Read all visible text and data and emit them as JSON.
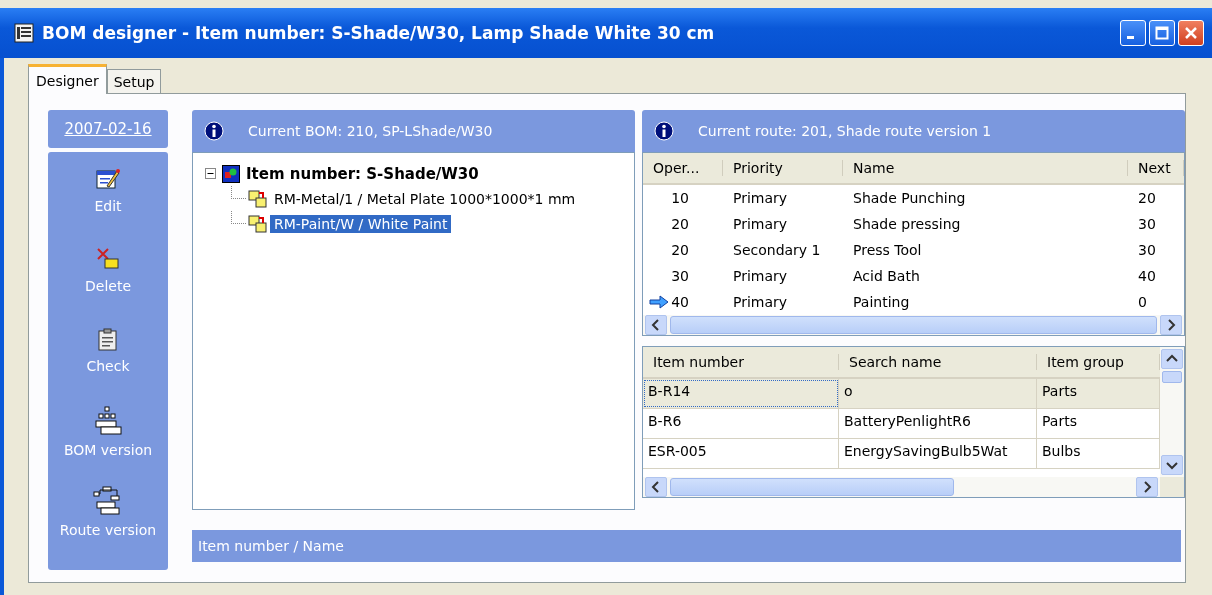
{
  "window": {
    "title": "BOM designer - Item number: S-Shade/W30, Lamp Shade White 30 cm"
  },
  "tabs": [
    {
      "label": "Designer",
      "selected": true
    },
    {
      "label": "Setup",
      "selected": false
    }
  ],
  "sidebar": {
    "date": "2007-02-16",
    "actions": [
      {
        "label": "Edit"
      },
      {
        "label": "Delete"
      },
      {
        "label": "Check"
      },
      {
        "label": "BOM version"
      },
      {
        "label": "Route version"
      }
    ]
  },
  "bom": {
    "header": "Current BOM:  210, SP-LShade/W30",
    "tree": {
      "label": "Item number: S-Shade/W30",
      "expanded": true,
      "children": [
        {
          "label": "RM-Metal/1 / Metal Plate 1000*1000*1 mm",
          "selected": false
        },
        {
          "label": "RM-Paint/W / White Paint",
          "selected": true
        }
      ]
    }
  },
  "route": {
    "header": "Current route:  201, Shade route version 1",
    "columns": [
      "Oper...",
      "Priority",
      "Name",
      "Next"
    ],
    "rows": [
      {
        "cells": [
          "10",
          "Primary",
          "Shade Punching",
          "20"
        ],
        "current": false
      },
      {
        "cells": [
          "20",
          "Primary",
          "Shade pressing",
          "30"
        ],
        "current": false
      },
      {
        "cells": [
          "20",
          "Secondary 1",
          "Press Tool",
          "30"
        ],
        "current": false
      },
      {
        "cells": [
          "30",
          "Primary",
          "Acid Bath",
          "40"
        ],
        "current": false
      },
      {
        "cells": [
          "40",
          "Primary",
          "Painting",
          "0"
        ],
        "current": true
      }
    ]
  },
  "items": {
    "columns": [
      "Item number",
      "Search name",
      "Item group"
    ],
    "rows": [
      {
        "cells": [
          "B-R14",
          "o",
          "Parts"
        ],
        "selected": true
      },
      {
        "cells": [
          "B-R6",
          "BatteryPenlightR6",
          "Parts"
        ],
        "selected": false
      },
      {
        "cells": [
          "ESR-005",
          "EnergySavingBulb5Wat",
          "Bulbs"
        ],
        "selected": false
      }
    ]
  },
  "filter_bar": {
    "label": "Item number / Name"
  }
}
